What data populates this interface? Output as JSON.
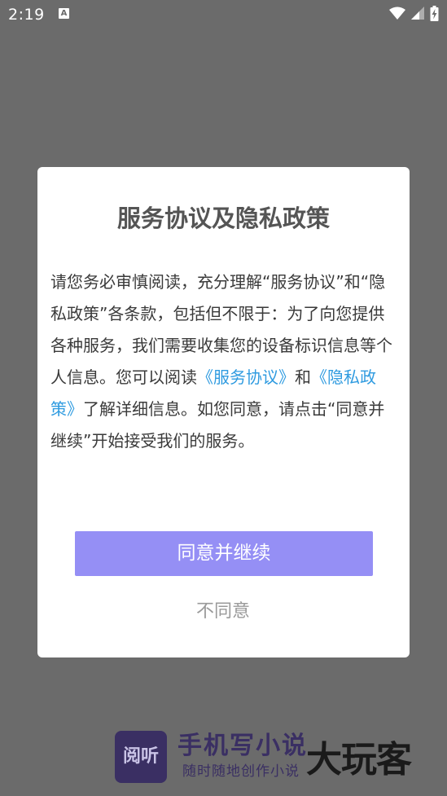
{
  "status_bar": {
    "time": "2:19",
    "notification_letter": "A"
  },
  "dialog": {
    "title": "服务协议及隐私政策",
    "body_part1": "请您务必审慎阅读，充分理解“服务协议”和“隐私政策”各条款，包括但不限于：为了向您提供各种服务，我们需要收集您的设备标识信息等个人信息。您可以阅读",
    "service_link": "《服务协议》",
    "body_part2": "和",
    "privacy_link": "《隐私政策》",
    "body_part3": "了解详细信息。如您同意，请点击“同意并继续”开始接受我们的服务。",
    "agree_label": "同意并继续",
    "decline_label": "不同意"
  },
  "brand": {
    "logo_text": "阅听",
    "name": "手机写小说",
    "slogan": "随时随地创作小说",
    "watermark": "大玩客"
  },
  "colors": {
    "overlay": "#6b6b6b",
    "dialog_bg": "#ffffff",
    "link": "#2f9be0",
    "primary_button": "#958ff5",
    "decline_text": "#9a9a9a",
    "brand": "#3a2f63"
  }
}
